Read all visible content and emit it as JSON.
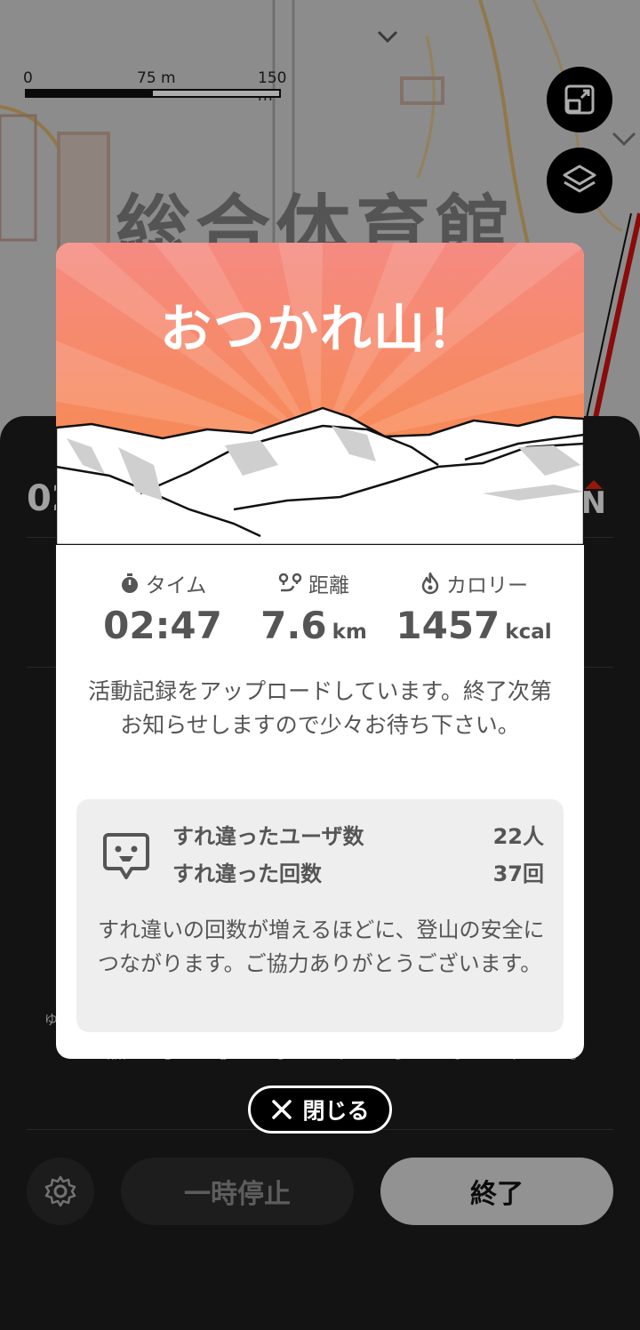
{
  "map": {
    "scale_labels": [
      "0",
      "75 m",
      "150 m"
    ],
    "place_label": "総合体育館",
    "buttons": [
      {
        "icon": "expand-icon"
      },
      {
        "icon": "layers-icon"
      }
    ]
  },
  "panel": {
    "time_partial": "02",
    "compass_label": "N",
    "axis_label": "ゆ",
    "axis_ticks": [
      "km",
      "1",
      "2",
      "3",
      "4",
      "5",
      "6",
      "7",
      "8"
    ],
    "settings_icon": "gear-icon",
    "pause_label": "一時停止",
    "end_label": "終了"
  },
  "modal": {
    "title": "おつかれ山！",
    "stats": [
      {
        "icon": "stopwatch-icon",
        "label": "タイム",
        "value": "02:47",
        "unit": ""
      },
      {
        "icon": "route-icon",
        "label": "距離",
        "value": "7.6",
        "unit": "km"
      },
      {
        "icon": "flame-icon",
        "label": "カロリー",
        "value": "1457",
        "unit": "kcal"
      }
    ],
    "upload_message": "活動記録をアップロードしています。終了次第お知らせしますので少々お待ち下さい。",
    "pass_box": {
      "icon": "encounter-chat-icon",
      "rows": [
        {
          "label": "すれ違ったユーザ数",
          "value": "22人"
        },
        {
          "label": "すれ違った回数",
          "value": "37回"
        }
      ],
      "note": "すれ違いの回数が増えるほどに、登山の安全につながります。ご協力ありがとうございます。"
    }
  },
  "close_button": {
    "icon": "close-icon",
    "label": "閉じる"
  },
  "colors": {
    "hero_top": "#f58a82",
    "hero_bottom": "#f88a40",
    "route_red": "#cc1111",
    "panel_bg": "#1c1c1c"
  }
}
